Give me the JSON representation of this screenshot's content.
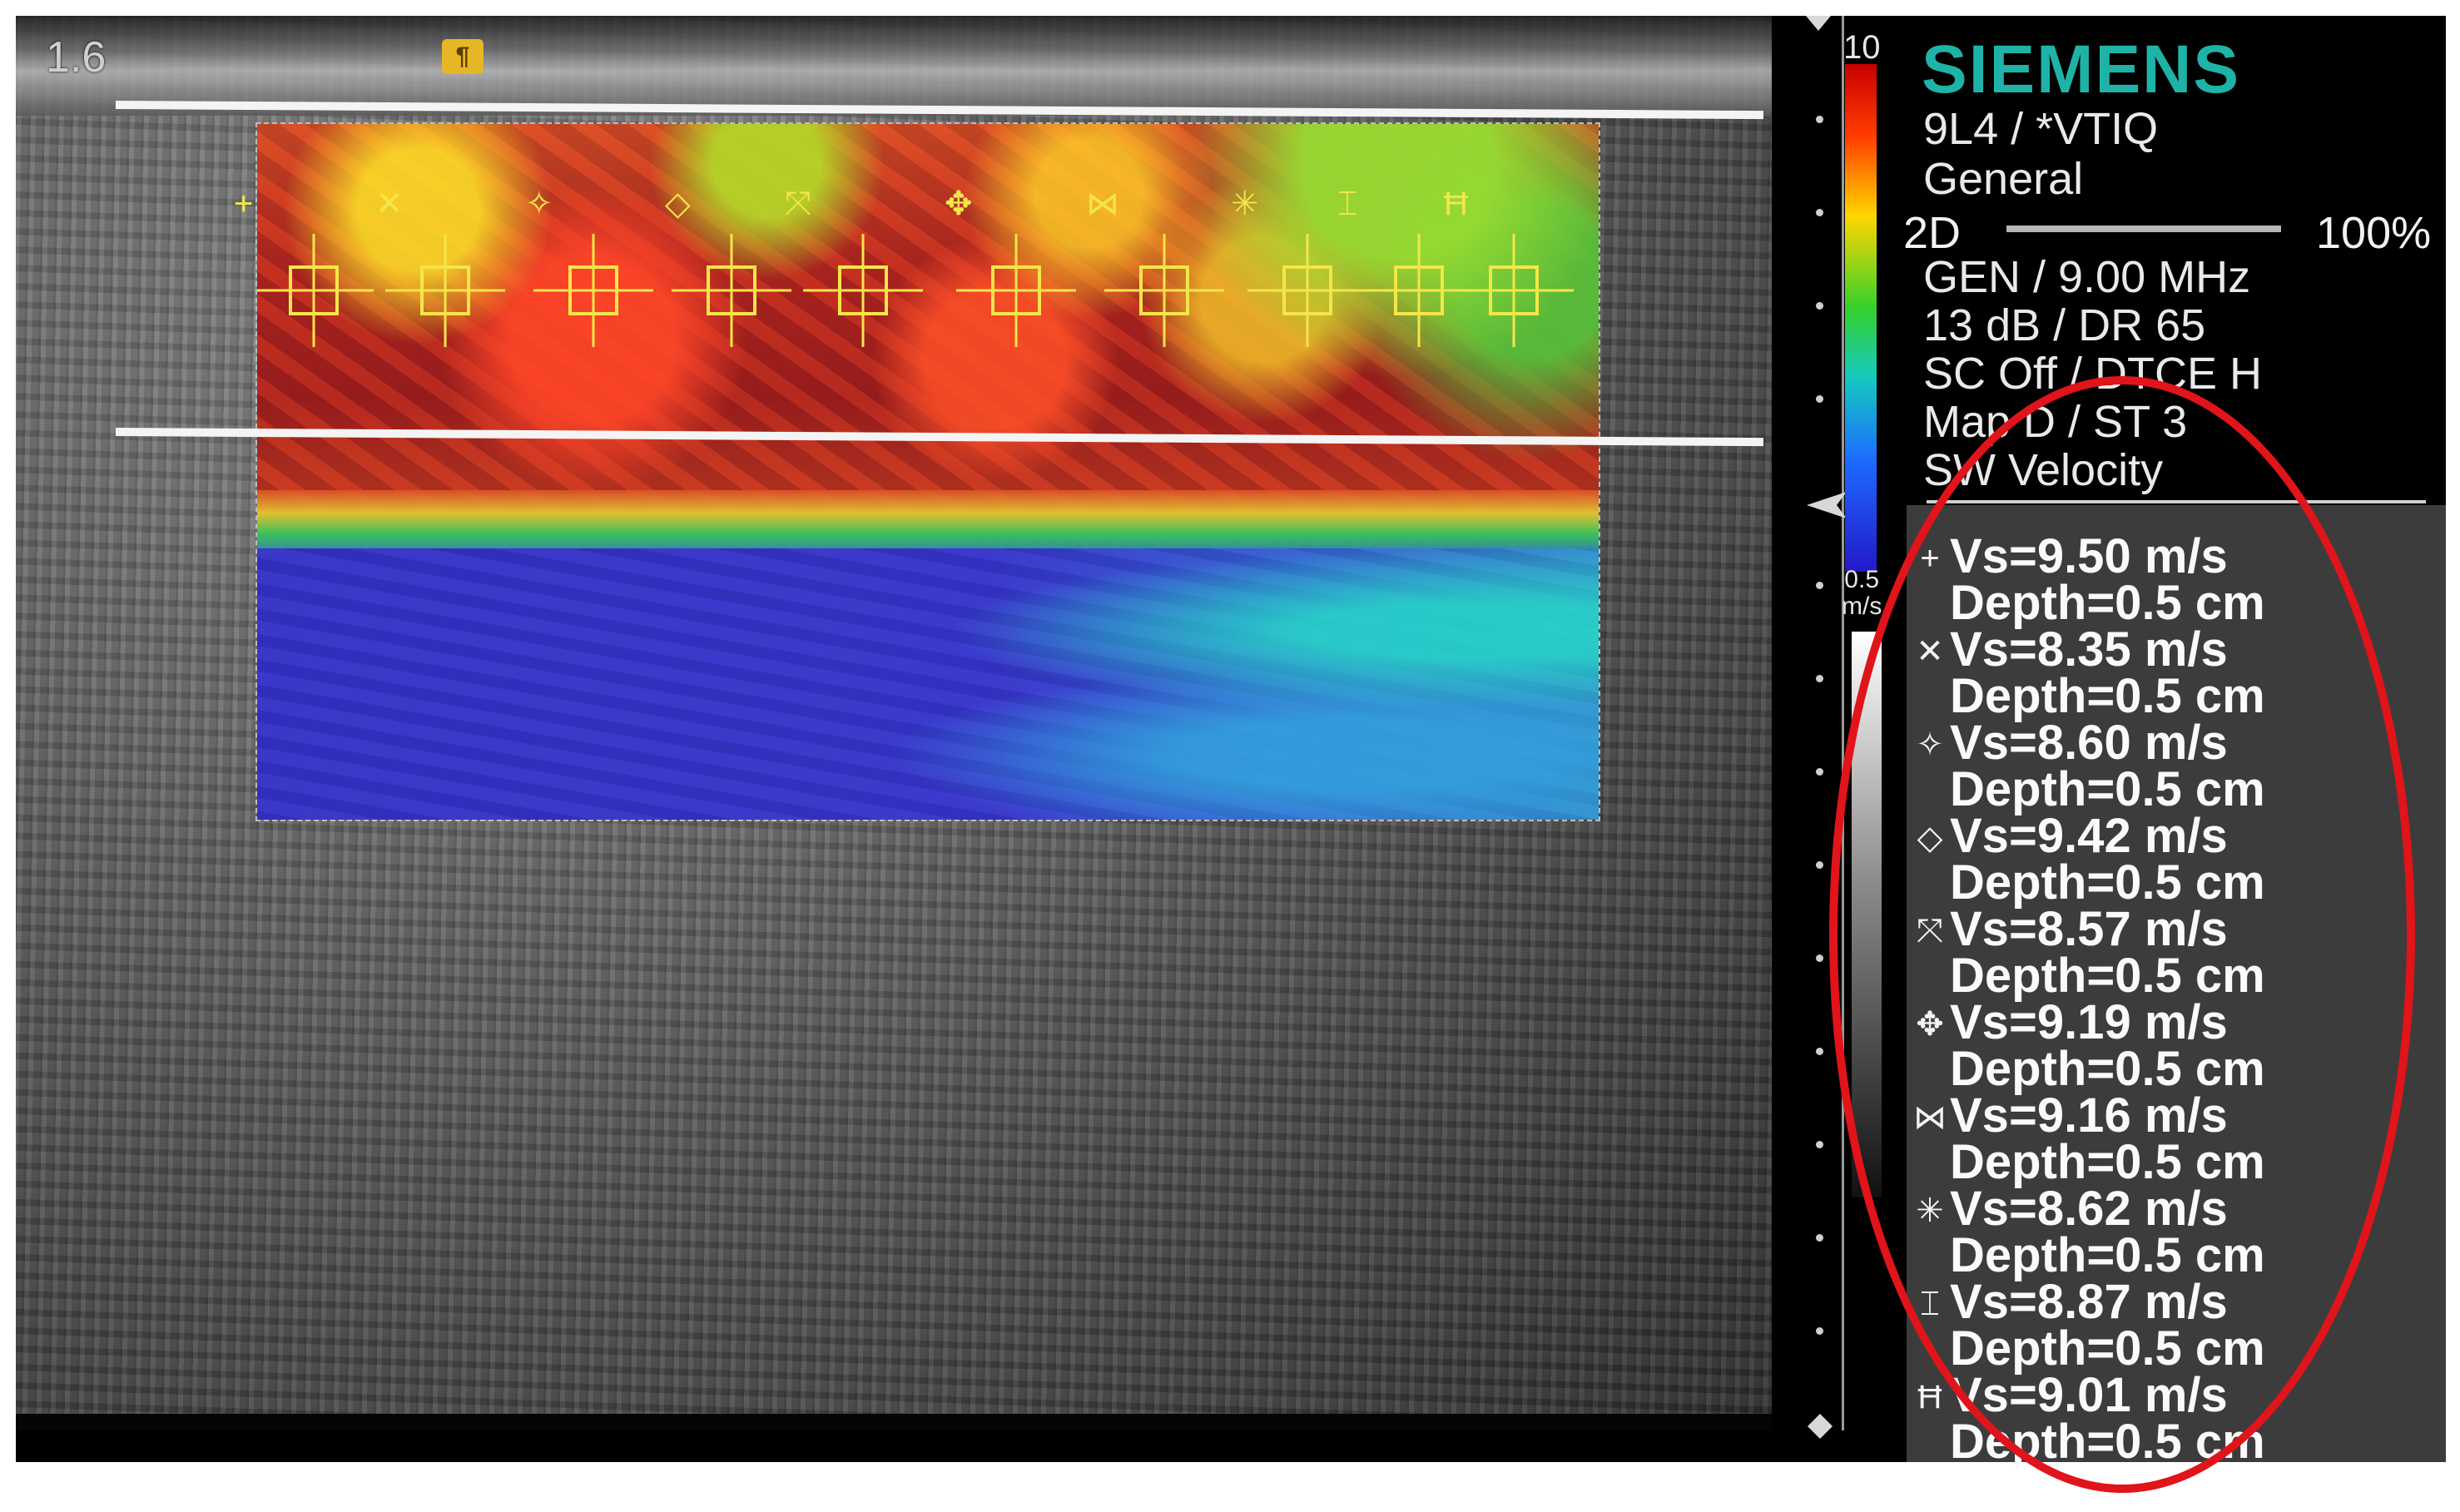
{
  "image": {
    "scale_label": "1.6",
    "bookmark_glyph": "¶"
  },
  "colorbar": {
    "max_label": "10",
    "min_label": "0.5",
    "unit_label": "m/s"
  },
  "info": {
    "brand": "SIEMENS",
    "transducer": "9L4 / *VTIQ",
    "preset": "General",
    "mode": "2D",
    "gain_pct": "100%",
    "frequency": "GEN / 9.00 MHz",
    "gain_dr": "13 dB / DR 65",
    "sc_dtce": "SC Off / DTCE H",
    "map": "Map D / ST 3",
    "display": "SW Velocity"
  },
  "measurements": [
    {
      "icon": "crosshair-plus-icon",
      "glyph": "+",
      "vs": "Vs=9.50 m/s",
      "depth": "Depth=0.5 cm"
    },
    {
      "icon": "x-cross-icon",
      "glyph": "✕",
      "vs": "Vs=8.35 m/s",
      "depth": "Depth=0.5 cm"
    },
    {
      "icon": "diamond-cross-icon",
      "glyph": "✧",
      "vs": "Vs=8.60 m/s",
      "depth": "Depth=0.5 cm"
    },
    {
      "icon": "diamond-icon",
      "glyph": "◇",
      "vs": "Vs=9.42 m/s",
      "depth": "Depth=0.5 cm"
    },
    {
      "icon": "expand-arrows-icon",
      "glyph": "⤧",
      "vs": "Vs=8.57 m/s",
      "depth": "Depth=0.5 cm"
    },
    {
      "icon": "compass-cross-icon",
      "glyph": "✥",
      "vs": "Vs=9.19 m/s",
      "depth": "Depth=0.5 cm"
    },
    {
      "icon": "contract-arrows-icon",
      "glyph": "⋈",
      "vs": "Vs=9.16 m/s",
      "depth": "Depth=0.5 cm"
    },
    {
      "icon": "asterisk-icon",
      "glyph": "✳",
      "vs": "Vs=8.62 m/s",
      "depth": "Depth=0.5 cm"
    },
    {
      "icon": "bracket-bars-icon",
      "glyph": "⌶",
      "vs": "Vs=8.87 m/s",
      "depth": "Depth=0.5 cm"
    },
    {
      "icon": "h-bars-icon",
      "glyph": "Ħ",
      "vs": "Vs=9.01 m/s",
      "depth": "Depth=0.5 cm"
    }
  ],
  "colors": {
    "brand": "#1fb3a8",
    "marker": "#f4e64a",
    "annotation_ellipse": "#e0141a",
    "panel_bg": "#3c3c3c"
  }
}
